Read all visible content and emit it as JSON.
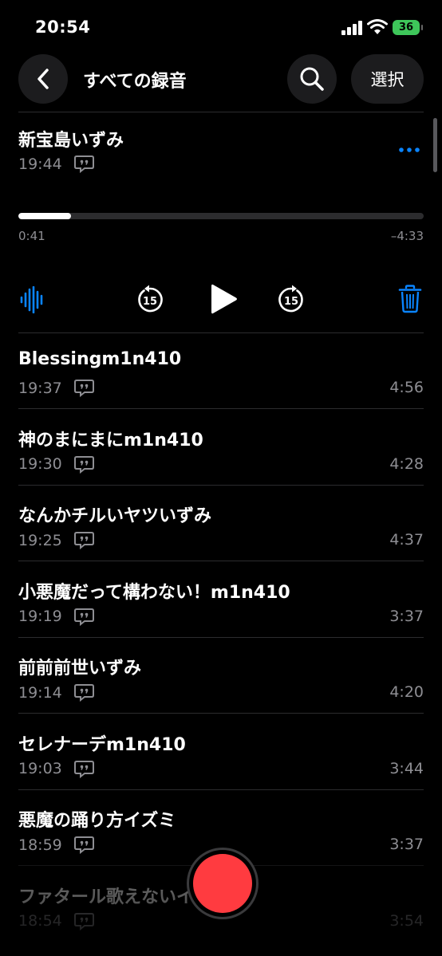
{
  "status": {
    "time": "20:54",
    "battery": "36"
  },
  "nav": {
    "title": "すべての録音",
    "select_label": "選択"
  },
  "colors": {
    "accent": "#0a84ff",
    "record": "#ff3b40",
    "secondary_text": "#8e8e93"
  },
  "expanded": {
    "title": "新宝島いずみ",
    "time": "19:44",
    "progress": 0.13,
    "elapsed": "0:41",
    "remaining": "–4:33",
    "skip_back": "15",
    "skip_forward": "15"
  },
  "recordings": [
    {
      "title": "Blessingm1n410",
      "time": "19:37",
      "duration": "4:56"
    },
    {
      "title": "神のまにまにm1n410",
      "time": "19:30",
      "duration": "4:28"
    },
    {
      "title": "なんかチルいヤツいずみ",
      "time": "19:25",
      "duration": "4:37"
    },
    {
      "title": "小悪魔だって構わない！m1n410",
      "time": "19:19",
      "duration": "3:37"
    },
    {
      "title": "前前前世いずみ",
      "time": "19:14",
      "duration": "4:20"
    },
    {
      "title": "セレナーデm1n410",
      "time": "19:03",
      "duration": "3:44"
    },
    {
      "title": "悪魔の踊り方イズミ",
      "time": "18:59",
      "duration": "3:37"
    },
    {
      "title": "ファタール歌えないイズミト",
      "time": "18:54",
      "duration": "3:54"
    }
  ]
}
